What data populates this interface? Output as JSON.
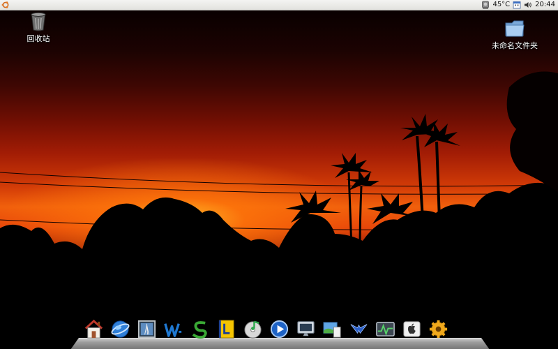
{
  "top_panel": {
    "menu_icon": "ubuntu-logo-icon",
    "tray": {
      "hdd_icon": "hard-disk-icon",
      "temperature": "45°C",
      "calendar_icon": "calendar-icon",
      "volume_icon": "speaker-volume-icon",
      "clock": "20:44"
    }
  },
  "desktop": {
    "icons": [
      {
        "label": "回收站",
        "icon": "trash-icon"
      },
      {
        "label": "未命名文件夹",
        "icon": "folder-icon"
      }
    ]
  },
  "dock": {
    "items": [
      {
        "icon": "home-icon"
      },
      {
        "icon": "web-browser-globe-icon"
      },
      {
        "icon": "picture-frame-icon"
      },
      {
        "icon": "wizard-w-icon"
      },
      {
        "icon": "green-s-app-icon"
      },
      {
        "icon": "dictionary-l-icon"
      },
      {
        "icon": "music-disc-icon"
      },
      {
        "icon": "media-player-icon"
      },
      {
        "icon": "monitor-display-icon"
      },
      {
        "icon": "image-viewer-icon"
      },
      {
        "icon": "bird-emblem-icon"
      },
      {
        "icon": "system-monitor-icon"
      },
      {
        "icon": "apple-logo-icon"
      },
      {
        "icon": "gear-settings-icon"
      }
    ]
  },
  "colors": {
    "sky_top": "#090000",
    "sky_glow": "#f1600c",
    "panel_bg": "#ecece8",
    "dock_shelf": "#a9a9a9"
  }
}
